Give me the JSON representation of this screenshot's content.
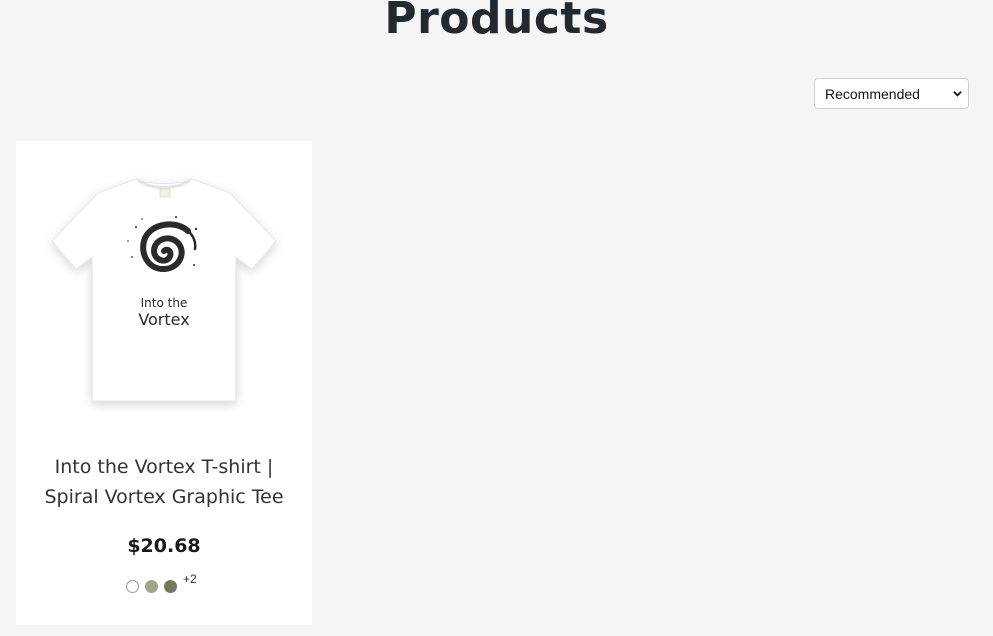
{
  "header": {
    "title": "Products"
  },
  "sort": {
    "selected": "Recommended",
    "icon": "chevron-down-icon"
  },
  "products": [
    {
      "name": "Into the Vortex T-shirt | Spiral Vortex Graphic Tee",
      "price": "$20.68",
      "image_text_line1": "Into the",
      "image_text_line2": "Vortex",
      "swatches": [
        "#ffffff",
        "#a3a28a",
        "#707a5c"
      ],
      "more_colors": "+2"
    }
  ]
}
